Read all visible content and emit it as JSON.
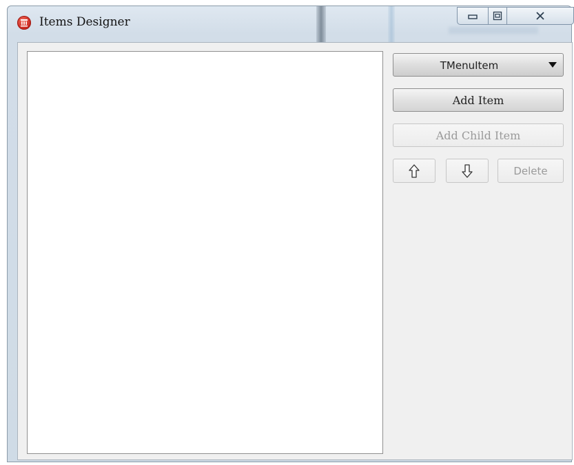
{
  "window": {
    "title": "Items Designer"
  },
  "icons": {
    "app": "app-icon",
    "minimize": "minimize-icon",
    "maximize": "maximize-icon",
    "close": "close-icon",
    "move_up": "arrow-up-icon",
    "move_down": "arrow-down-icon"
  },
  "type_selector": {
    "value": "TMenuItem"
  },
  "buttons": {
    "add_item": "Add Item",
    "add_child_item": "Add Child Item",
    "delete": "Delete"
  },
  "colors": {
    "accent_icon": "#c8241c"
  }
}
